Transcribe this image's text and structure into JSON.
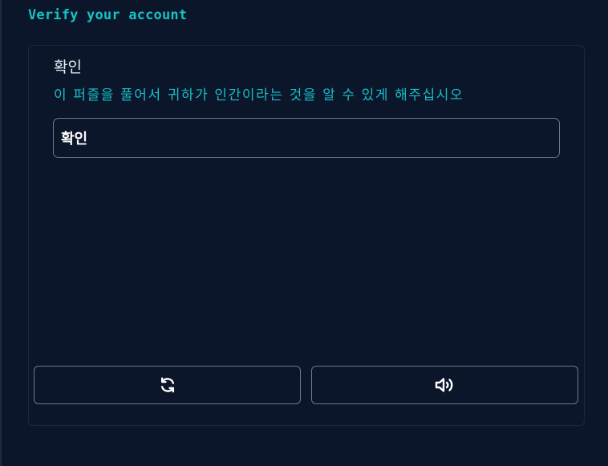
{
  "page": {
    "title": "Verify your account"
  },
  "captcha": {
    "heading": "확인",
    "instruction": "이 퍼즐을 풀어서 귀하가 인간이라는 것을 알 수 있게 해주십시오",
    "answer_value": "확인",
    "refresh_icon": "refresh-icon",
    "audio_icon": "speaker-icon"
  },
  "colors": {
    "background": "#0b162b",
    "accent": "#16c2c2",
    "border": "#6d7891",
    "text": "#ffffff"
  }
}
